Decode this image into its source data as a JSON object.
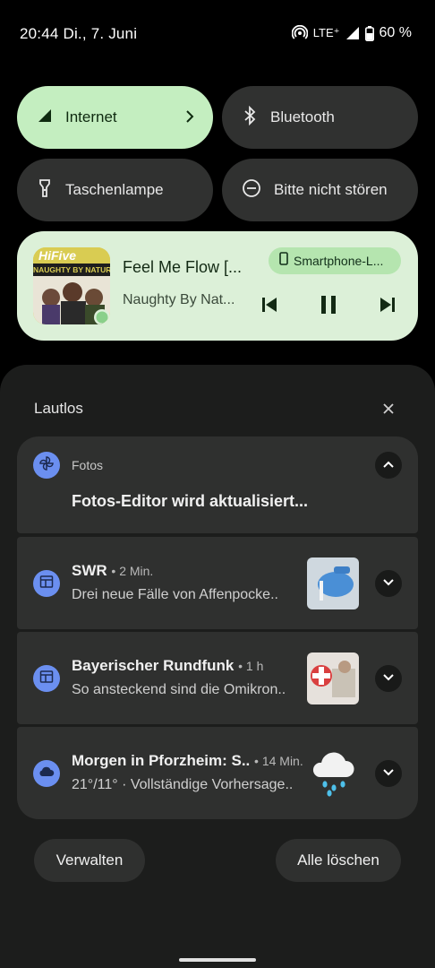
{
  "status": {
    "time_date": "20:44 Di., 7. Juni",
    "network": "LTE⁺",
    "battery": "60 %"
  },
  "tiles": [
    {
      "label": "Internet",
      "active": true,
      "icon": "signal-icon"
    },
    {
      "label": "Bluetooth",
      "active": false,
      "icon": "bluetooth-icon"
    },
    {
      "label": "Taschenlampe",
      "active": false,
      "icon": "flashlight-icon"
    },
    {
      "label": "Bitte nicht stören",
      "active": false,
      "icon": "do-not-disturb-icon"
    }
  ],
  "media": {
    "title": "Feel Me Flow [...",
    "artist": "Naughty By Nat...",
    "output_device": "Smartphone-L...",
    "album_art_text": {
      "top": "HiFive",
      "band": "NAUGHTY BY NATURE"
    }
  },
  "shade": {
    "section_title": "Lautlos",
    "notifications": [
      {
        "app": "Fotos",
        "title": "Fotos-Editor wird aktualisiert..."
      },
      {
        "title": "SWR",
        "time": "• 2 Min.",
        "text": "Drei neue Fälle von Affenpocke.."
      },
      {
        "title": "Bayerischer Rundfunk",
        "time": "• 1 h",
        "text": "So ansteckend sind die Omikron.."
      },
      {
        "title": "Morgen in Pforzheim: S..",
        "time": "• 14 Min.",
        "text": "21°/11° · Vollständige Vorhersage.."
      }
    ],
    "manage_label": "Verwalten",
    "clear_all_label": "Alle löschen"
  },
  "colors": {
    "active_tile": "#c4eec0",
    "media_card": "#dcf0d8",
    "app_icon": "#6b8ff0",
    "card_bg": "#2f302f"
  }
}
